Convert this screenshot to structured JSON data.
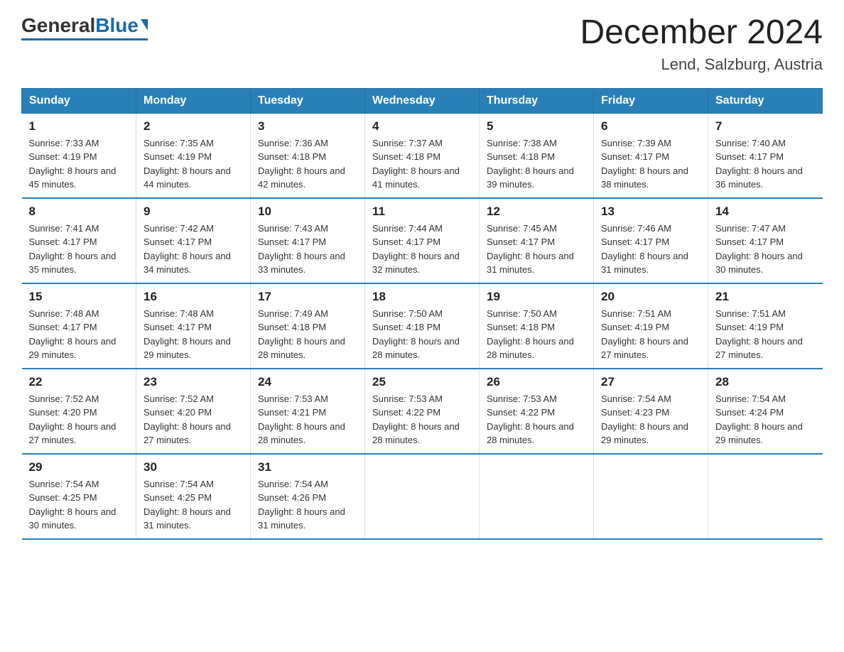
{
  "header": {
    "logo": {
      "general": "General",
      "blue": "Blue"
    },
    "month": "December 2024",
    "location": "Lend, Salzburg, Austria"
  },
  "days_of_week": [
    "Sunday",
    "Monday",
    "Tuesday",
    "Wednesday",
    "Thursday",
    "Friday",
    "Saturday"
  ],
  "weeks": [
    [
      {
        "day": "1",
        "sunrise": "7:33 AM",
        "sunset": "4:19 PM",
        "daylight": "8 hours and 45 minutes."
      },
      {
        "day": "2",
        "sunrise": "7:35 AM",
        "sunset": "4:19 PM",
        "daylight": "8 hours and 44 minutes."
      },
      {
        "day": "3",
        "sunrise": "7:36 AM",
        "sunset": "4:18 PM",
        "daylight": "8 hours and 42 minutes."
      },
      {
        "day": "4",
        "sunrise": "7:37 AM",
        "sunset": "4:18 PM",
        "daylight": "8 hours and 41 minutes."
      },
      {
        "day": "5",
        "sunrise": "7:38 AM",
        "sunset": "4:18 PM",
        "daylight": "8 hours and 39 minutes."
      },
      {
        "day": "6",
        "sunrise": "7:39 AM",
        "sunset": "4:17 PM",
        "daylight": "8 hours and 38 minutes."
      },
      {
        "day": "7",
        "sunrise": "7:40 AM",
        "sunset": "4:17 PM",
        "daylight": "8 hours and 36 minutes."
      }
    ],
    [
      {
        "day": "8",
        "sunrise": "7:41 AM",
        "sunset": "4:17 PM",
        "daylight": "8 hours and 35 minutes."
      },
      {
        "day": "9",
        "sunrise": "7:42 AM",
        "sunset": "4:17 PM",
        "daylight": "8 hours and 34 minutes."
      },
      {
        "day": "10",
        "sunrise": "7:43 AM",
        "sunset": "4:17 PM",
        "daylight": "8 hours and 33 minutes."
      },
      {
        "day": "11",
        "sunrise": "7:44 AM",
        "sunset": "4:17 PM",
        "daylight": "8 hours and 32 minutes."
      },
      {
        "day": "12",
        "sunrise": "7:45 AM",
        "sunset": "4:17 PM",
        "daylight": "8 hours and 31 minutes."
      },
      {
        "day": "13",
        "sunrise": "7:46 AM",
        "sunset": "4:17 PM",
        "daylight": "8 hours and 31 minutes."
      },
      {
        "day": "14",
        "sunrise": "7:47 AM",
        "sunset": "4:17 PM",
        "daylight": "8 hours and 30 minutes."
      }
    ],
    [
      {
        "day": "15",
        "sunrise": "7:48 AM",
        "sunset": "4:17 PM",
        "daylight": "8 hours and 29 minutes."
      },
      {
        "day": "16",
        "sunrise": "7:48 AM",
        "sunset": "4:17 PM",
        "daylight": "8 hours and 29 minutes."
      },
      {
        "day": "17",
        "sunrise": "7:49 AM",
        "sunset": "4:18 PM",
        "daylight": "8 hours and 28 minutes."
      },
      {
        "day": "18",
        "sunrise": "7:50 AM",
        "sunset": "4:18 PM",
        "daylight": "8 hours and 28 minutes."
      },
      {
        "day": "19",
        "sunrise": "7:50 AM",
        "sunset": "4:18 PM",
        "daylight": "8 hours and 28 minutes."
      },
      {
        "day": "20",
        "sunrise": "7:51 AM",
        "sunset": "4:19 PM",
        "daylight": "8 hours and 27 minutes."
      },
      {
        "day": "21",
        "sunrise": "7:51 AM",
        "sunset": "4:19 PM",
        "daylight": "8 hours and 27 minutes."
      }
    ],
    [
      {
        "day": "22",
        "sunrise": "7:52 AM",
        "sunset": "4:20 PM",
        "daylight": "8 hours and 27 minutes."
      },
      {
        "day": "23",
        "sunrise": "7:52 AM",
        "sunset": "4:20 PM",
        "daylight": "8 hours and 27 minutes."
      },
      {
        "day": "24",
        "sunrise": "7:53 AM",
        "sunset": "4:21 PM",
        "daylight": "8 hours and 28 minutes."
      },
      {
        "day": "25",
        "sunrise": "7:53 AM",
        "sunset": "4:22 PM",
        "daylight": "8 hours and 28 minutes."
      },
      {
        "day": "26",
        "sunrise": "7:53 AM",
        "sunset": "4:22 PM",
        "daylight": "8 hours and 28 minutes."
      },
      {
        "day": "27",
        "sunrise": "7:54 AM",
        "sunset": "4:23 PM",
        "daylight": "8 hours and 29 minutes."
      },
      {
        "day": "28",
        "sunrise": "7:54 AM",
        "sunset": "4:24 PM",
        "daylight": "8 hours and 29 minutes."
      }
    ],
    [
      {
        "day": "29",
        "sunrise": "7:54 AM",
        "sunset": "4:25 PM",
        "daylight": "8 hours and 30 minutes."
      },
      {
        "day": "30",
        "sunrise": "7:54 AM",
        "sunset": "4:25 PM",
        "daylight": "8 hours and 31 minutes."
      },
      {
        "day": "31",
        "sunrise": "7:54 AM",
        "sunset": "4:26 PM",
        "daylight": "8 hours and 31 minutes."
      },
      null,
      null,
      null,
      null
    ]
  ]
}
